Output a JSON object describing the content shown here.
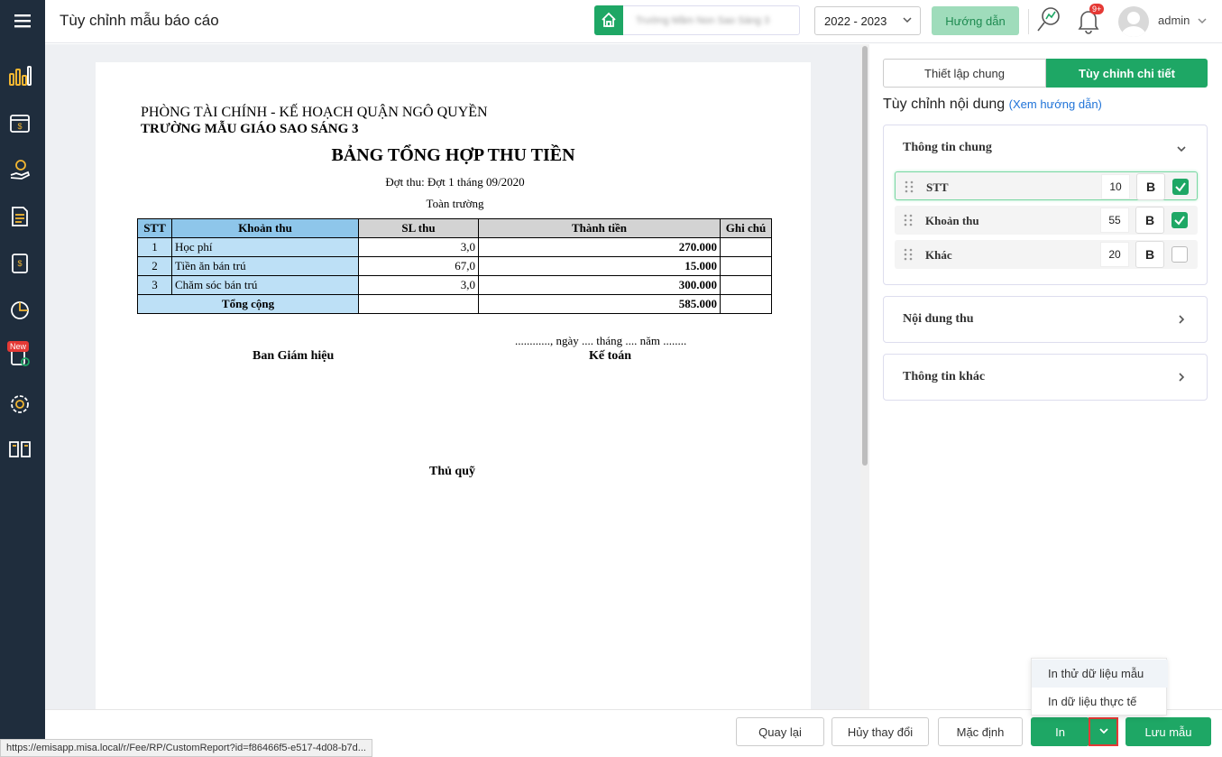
{
  "header": {
    "title": "Tùy chỉnh mẫu báo cáo",
    "school_name": "Trường Mầm Non Sao Sáng 3",
    "year": "2022 - 2023",
    "guide_label": "Hướng dẫn",
    "notification_count": "9+",
    "username": "admin"
  },
  "sidebar": {
    "items": [
      "menu-icon",
      "dashboard-icon",
      "fee-calendar-icon",
      "payment-icon",
      "document-icon",
      "ledger-icon",
      "report-chart-icon",
      "new-feature-icon",
      "settings-icon",
      "book-icon"
    ],
    "new_badge": "New"
  },
  "report": {
    "line1": "PHÒNG TÀI CHÍNH - KẾ HOẠCH QUẬN NGÔ QUYỀN",
    "line2": "TRƯỜNG MẪU GIÁO SAO SÁNG 3",
    "title": "BẢNG TỔNG HỢP THU TIỀN",
    "period": "Đợt thu: Đợt 1 tháng 09/2020",
    "scope": "Toàn trường",
    "columns": [
      "STT",
      "Khoản thu",
      "SL thu",
      "Thành tiền",
      "Ghi chú"
    ],
    "rows": [
      {
        "stt": "1",
        "name": "Học phí",
        "qty": "3,0",
        "amount": "270.000",
        "note": ""
      },
      {
        "stt": "2",
        "name": "Tiền ăn bán trú",
        "qty": "67,0",
        "amount": "15.000",
        "note": ""
      },
      {
        "stt": "3",
        "name": "Chăm sóc bán trú",
        "qty": "3,0",
        "amount": "300.000",
        "note": ""
      }
    ],
    "total_label": "Tổng cộng",
    "total_amount": "585.000",
    "date_line": "............, ngày .... tháng .... năm ........",
    "sign_board": "Ban Giám hiệu",
    "sign_accountant": "Kế toán",
    "sign_treasurer": "Thủ quỹ"
  },
  "panel": {
    "tab_general": "Thiết lập chung",
    "tab_detail": "Tùy chỉnh chi tiết",
    "content_title": "Tùy chỉnh nội dung",
    "guide_link": "(Xem hướng dẫn)",
    "section_general": "Thông tin chung",
    "fields": [
      {
        "name": "STT",
        "width": "10",
        "bold": "B",
        "checked": true
      },
      {
        "name": "Khoản thu",
        "width": "55",
        "bold": "B",
        "checked": true
      },
      {
        "name": "Khác",
        "width": "20",
        "bold": "B",
        "checked": false
      }
    ],
    "section_content": "Nội dung thu",
    "section_other": "Thông tin khác"
  },
  "print_menu": {
    "sample": "In thử dữ liệu mẫu",
    "actual": "In dữ liệu thực tế"
  },
  "footer": {
    "back": "Quay lại",
    "discard": "Hủy thay đổi",
    "default": "Mặc định",
    "print": "In",
    "save": "Lưu mẫu"
  },
  "status_url": "https://emisapp.misa.local/r/Fee/RP/CustomReport?id=f86466f5-e517-4d08-b7d...",
  "colors": {
    "accent": "#1ea765",
    "sidebar": "#1f2d3d",
    "link": "#1f73d8",
    "highlight": "#bde0f6",
    "alert": "#e53935"
  }
}
